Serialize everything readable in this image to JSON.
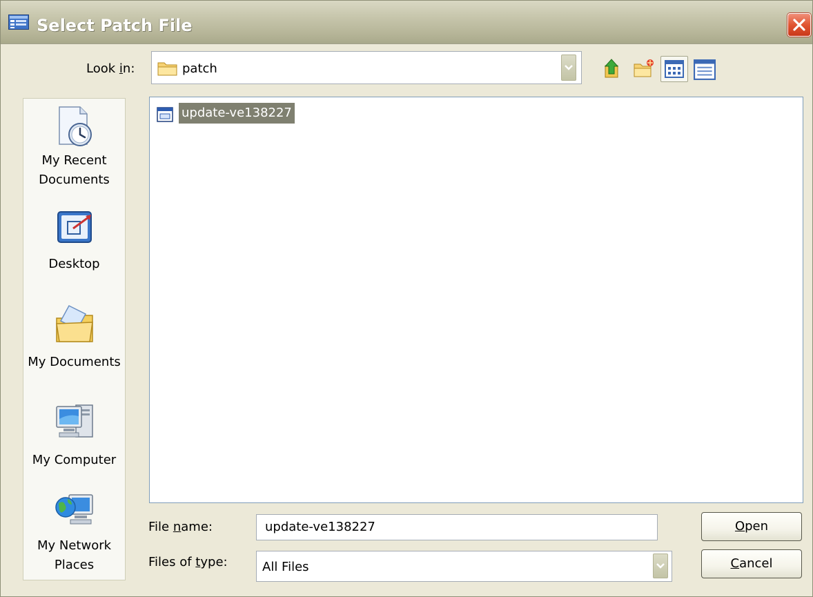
{
  "window": {
    "title": "Select Patch File",
    "app_icon": "dialog-app-icon",
    "close_icon": "close-icon"
  },
  "lookin": {
    "label_pre": "Look ",
    "label_accel": "i",
    "label_post": "n:",
    "value": "patch",
    "icon": "folder-icon"
  },
  "toolbar": {
    "icons": [
      "up-one-level-icon",
      "create-new-folder-icon",
      "view-menu-icon",
      "details-view-icon"
    ]
  },
  "places": [
    {
      "id": "recent",
      "line1": "My Recent",
      "line2": "Documents",
      "icon": "recent-documents-icon"
    },
    {
      "id": "desktop",
      "line1": "Desktop",
      "line2": "",
      "icon": "desktop-icon"
    },
    {
      "id": "documents",
      "line1": "My Documents",
      "line2": "",
      "icon": "my-documents-icon"
    },
    {
      "id": "computer",
      "line1": "My Computer",
      "line2": "",
      "icon": "my-computer-icon"
    },
    {
      "id": "network",
      "line1": "My Network",
      "line2": "Places",
      "icon": "my-network-places-icon"
    }
  ],
  "files": [
    {
      "name": "update-ve138227",
      "icon": "application-file-icon",
      "selected": true
    }
  ],
  "filename": {
    "label_pre": "File ",
    "label_accel": "n",
    "label_post": "ame:",
    "value": "update-ve138227"
  },
  "filetype": {
    "label_pre": "Files of ",
    "label_accel": "t",
    "label_post": "ype:",
    "value": "All Files"
  },
  "buttons": {
    "open_accel": "O",
    "open_rest": "pen",
    "cancel_accel": "C",
    "cancel_rest": "ancel"
  },
  "colors": {
    "dialog_bg": "#ece9d8",
    "selection": "#7f8070",
    "close_red": "#e15532"
  }
}
